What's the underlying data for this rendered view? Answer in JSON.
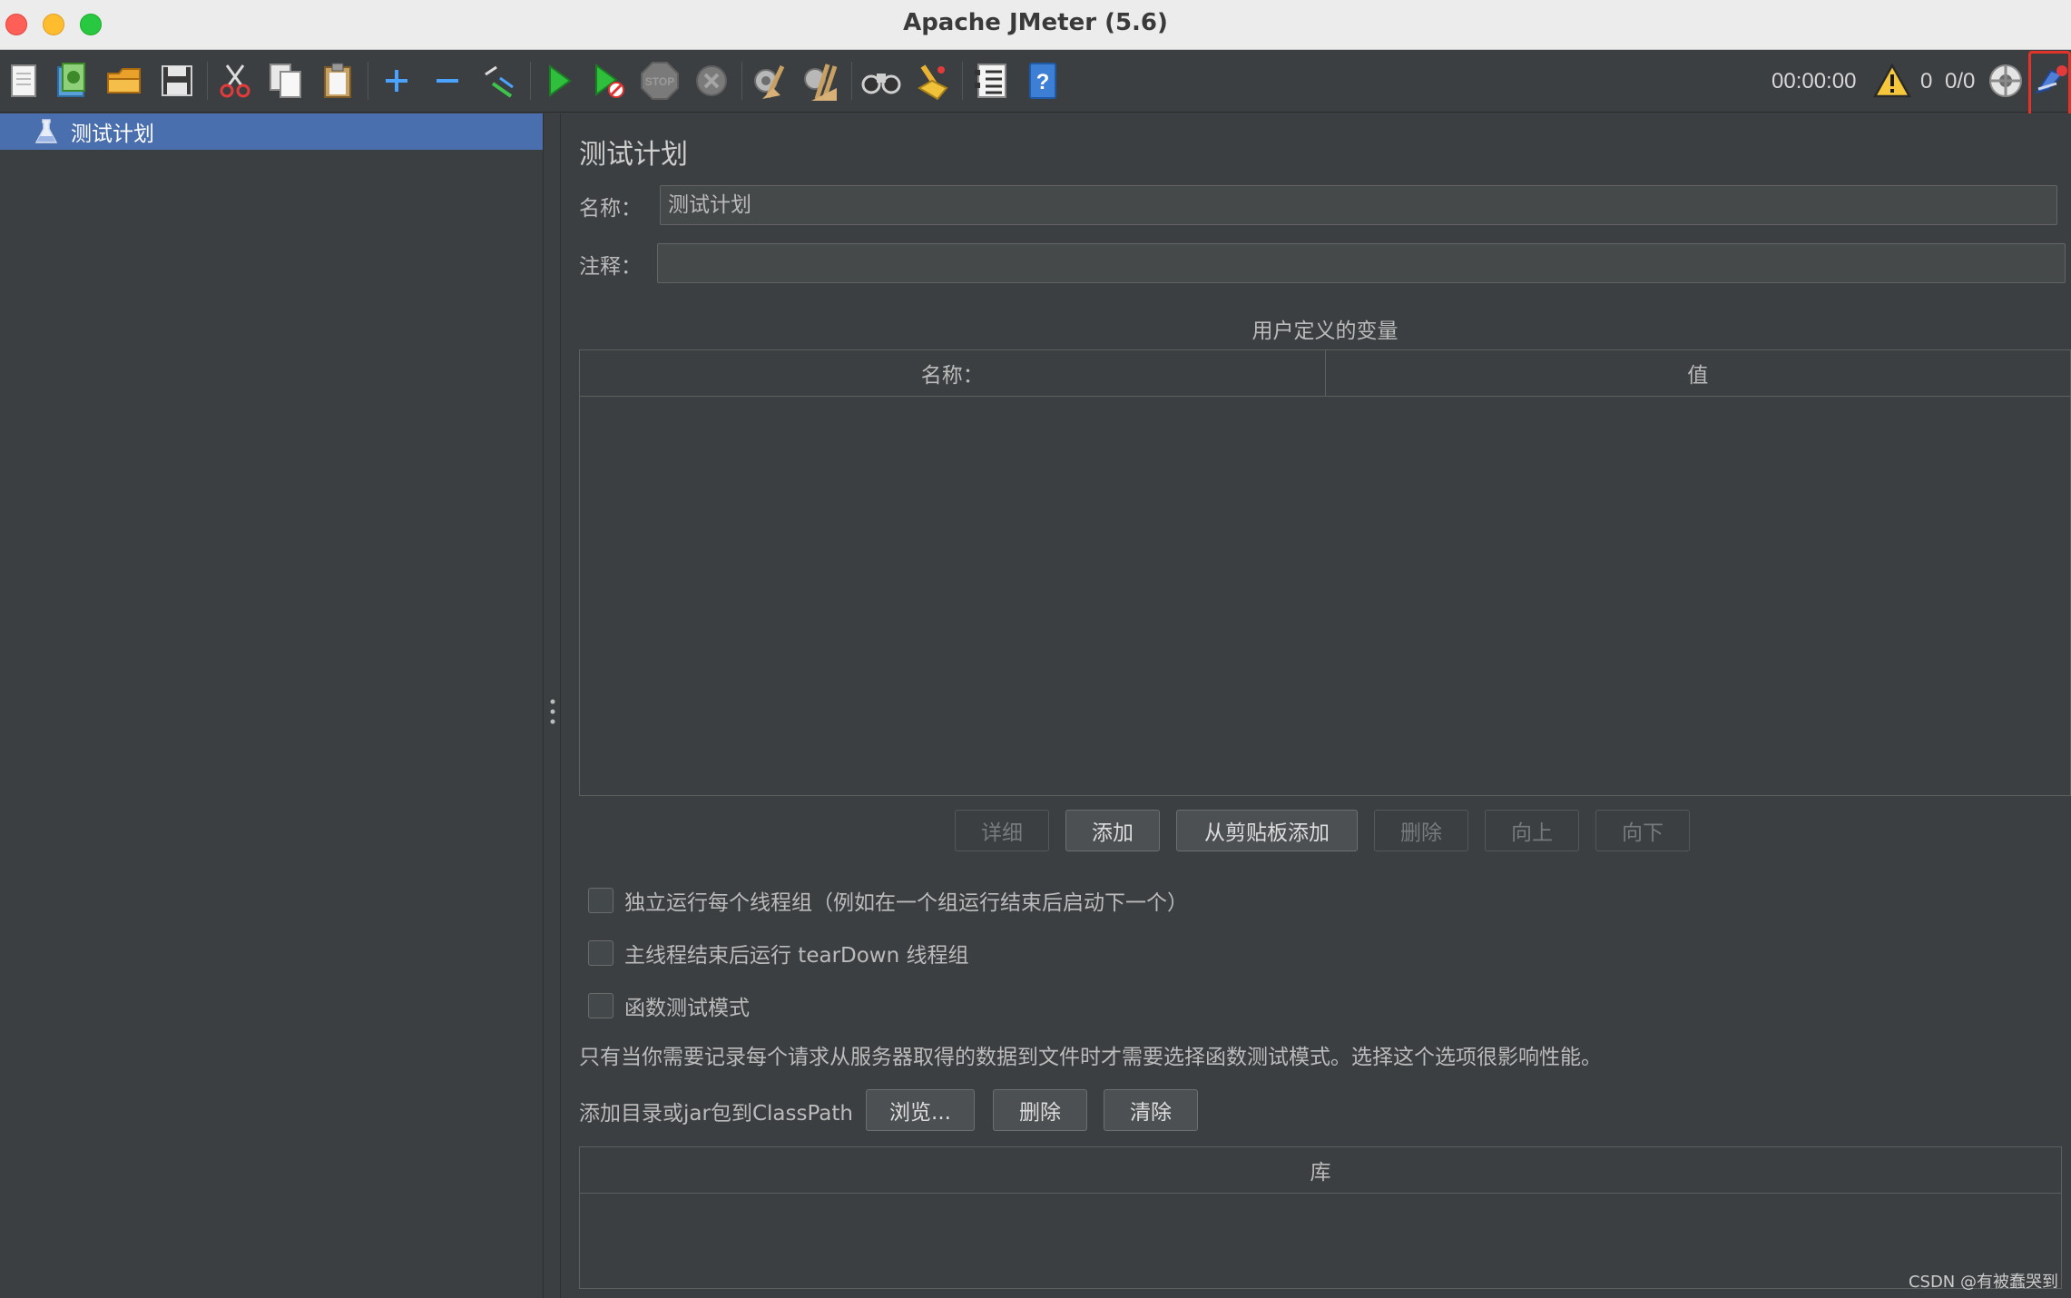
{
  "window": {
    "title": "Apache JMeter (5.6)"
  },
  "toolbar": {
    "icons": [
      "new-icon",
      "templates-icon",
      "open-icon",
      "save-icon",
      "cut-icon",
      "copy-icon",
      "paste-icon",
      "expand-icon",
      "collapse-icon",
      "toggle-icon",
      "start-icon",
      "start-no-pause-icon",
      "stop-icon",
      "shutdown-icon",
      "clear-icon",
      "clear-all-icon",
      "search-icon",
      "reset-search-icon",
      "function-helper-icon",
      "help-icon"
    ],
    "timer": "00:00:00",
    "warning_count": "0",
    "threads": "0/0"
  },
  "tree": {
    "items": [
      {
        "label": "测试计划"
      }
    ]
  },
  "main": {
    "title": "测试计划",
    "name_label": "名称：",
    "name_value": "测试计划",
    "comment_label": "注释：",
    "comment_value": "",
    "variables": {
      "title": "用户定义的变量",
      "columns": [
        "名称：",
        "值"
      ],
      "rows": []
    },
    "variable_buttons": {
      "detail": "详细",
      "add": "添加",
      "add_from_clipboard": "从剪贴板添加",
      "delete": "删除",
      "up": "向上",
      "down": "向下"
    },
    "checkboxes": [
      {
        "label": "独立运行每个线程组（例如在一个组运行结束后启动下一个）",
        "checked": false
      },
      {
        "label": "主线程结束后运行 tearDown 线程组",
        "checked": false
      },
      {
        "label": "函数测试模式",
        "checked": false
      }
    ],
    "functional_note": "只有当你需要记录每个请求从服务器取得的数据到文件时才需要选择函数测试模式。选择这个选项很影响性能。",
    "classpath": {
      "label": "添加目录或jar包到ClassPath",
      "browse": "浏览...",
      "delete": "删除",
      "clear": "清除",
      "library_column": "库"
    }
  },
  "watermark": "CSDN @有被蠢哭到"
}
